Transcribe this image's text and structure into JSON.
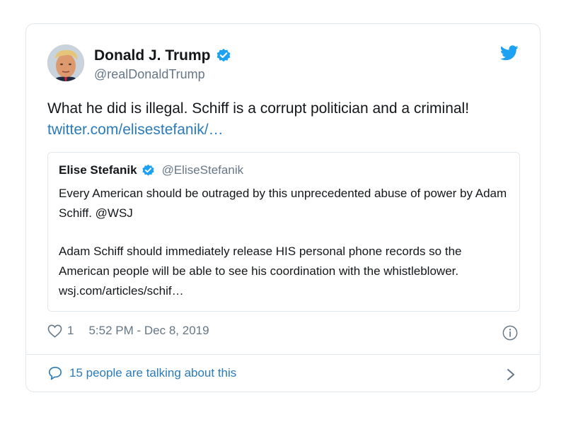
{
  "author": {
    "name": "Donald J. Trump",
    "handle": "@realDonaldTrump",
    "verified": true,
    "avatar_icon": "profile-photo"
  },
  "tweet": {
    "text": "What he did is illegal. Schiff is a corrupt politician and a criminal!",
    "link": "twitter.com/elisestefanik/…"
  },
  "quoted_tweet": {
    "name": "Elise Stefanik",
    "handle": "@EliseStefanik",
    "verified": true,
    "paragraphs": [
      "Every American should be outraged by this unprecedented abuse of power by Adam Schiff. @WSJ",
      "Adam Schiff should immediately release HIS personal phone records so the American people will be able to see his coordination with the whistleblower.  wsj.com/articles/schif…"
    ]
  },
  "meta": {
    "like_count": "1",
    "timestamp": "5:52 PM - Dec 8, 2019"
  },
  "footer": {
    "talking_text": "15 people are talking about this"
  },
  "colors": {
    "twitter_blue": "#1da1f2",
    "link_blue": "#2b7bb9",
    "secondary_text": "#657786",
    "border": "#e1e8ed"
  }
}
